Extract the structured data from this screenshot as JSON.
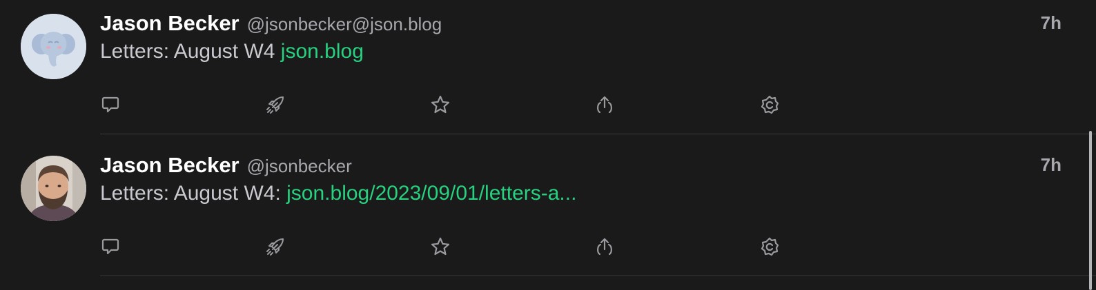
{
  "posts": [
    {
      "author_name": "Jason Becker",
      "handle": "@jsonbecker@json.blog",
      "time": "7h",
      "text": "Letters: August W4 ",
      "link_text": "json.blog",
      "avatar": "elephant-avatar"
    },
    {
      "author_name": "Jason Becker",
      "handle": "@jsonbecker",
      "time": "7h",
      "text": "Letters: August W4: ",
      "link_text": "json.blog/2023/09/01/letters-a...",
      "avatar": "photo-avatar"
    }
  ],
  "actions": [
    "reply-icon",
    "boost-icon",
    "favorite-icon",
    "share-icon",
    "more-icon"
  ],
  "colors": {
    "background": "#1a1a1a",
    "link": "#27d17f",
    "secondary_text": "#a7a8ad",
    "icon": "#9a9a9f"
  }
}
